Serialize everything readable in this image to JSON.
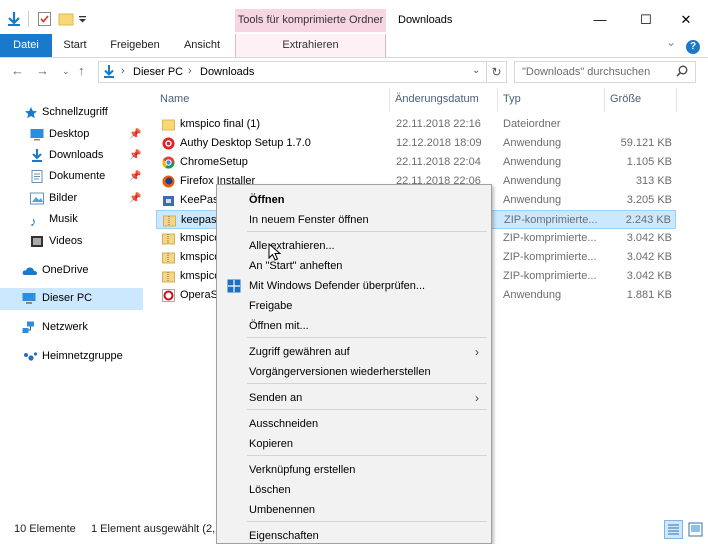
{
  "window": {
    "title": "Downloads",
    "context_tab": "Tools für komprimierte Ordner",
    "minimize_glyph": "—",
    "maximize_glyph": "☐",
    "close_glyph": "✕"
  },
  "ribbon": {
    "tabs": [
      "Datei",
      "Start",
      "Freigeben",
      "Ansicht",
      "Extrahieren"
    ],
    "expand_glyph": "⌄",
    "help_glyph": "?"
  },
  "address": {
    "breadcrumb": [
      "Dieser PC",
      "Downloads"
    ],
    "search_placeholder": "\"Downloads\" durchsuchen"
  },
  "navigation": {
    "items": [
      {
        "label": "Schnellzugriff",
        "icon": "star-icon",
        "pinned": false
      },
      {
        "label": "Desktop",
        "icon": "desktop-icon",
        "pinned": true
      },
      {
        "label": "Downloads",
        "icon": "download-arrow-icon",
        "pinned": true
      },
      {
        "label": "Dokumente",
        "icon": "document-icon",
        "pinned": true
      },
      {
        "label": "Bilder",
        "icon": "pictures-icon",
        "pinned": true
      },
      {
        "label": "Musik",
        "icon": "music-icon",
        "pinned": false
      },
      {
        "label": "Videos",
        "icon": "video-icon",
        "pinned": false
      },
      {
        "label": "OneDrive",
        "icon": "cloud-icon",
        "pinned": false
      },
      {
        "label": "Dieser PC",
        "icon": "computer-icon",
        "pinned": false
      },
      {
        "label": "Netzwerk",
        "icon": "network-icon",
        "pinned": false
      },
      {
        "label": "Heimnetzgruppe",
        "icon": "homegroup-icon",
        "pinned": false
      }
    ]
  },
  "filelist": {
    "columns": [
      "Name",
      "Änderungsdatum",
      "Typ",
      "Größe"
    ],
    "rows": [
      {
        "name": "kmspico final (1)",
        "date": "22.11.2018 22:16",
        "type": "Dateiordner",
        "size": "",
        "icon": "folder-icon"
      },
      {
        "name": "Authy Desktop Setup 1.7.0",
        "date": "12.12.2018 18:09",
        "type": "Anwendung",
        "size": "59.121 KB",
        "icon": "authy-icon"
      },
      {
        "name": "ChromeSetup",
        "date": "22.11.2018 22:04",
        "type": "Anwendung",
        "size": "1.105 KB",
        "icon": "chrome-icon"
      },
      {
        "name": "Firefox Installer",
        "date": "22.11.2018 22:06",
        "type": "Anwendung",
        "size": "313 KB",
        "icon": "firefox-icon"
      },
      {
        "name": "KeePass",
        "date": "",
        "type": "Anwendung",
        "size": "3.205 KB",
        "icon": "keepass-icon"
      },
      {
        "name": "keepass",
        "date": "",
        "type": "ZIP-komprimierte...",
        "size": "2.243 KB",
        "icon": "zip-folder-icon"
      },
      {
        "name": "kmspico",
        "date": "",
        "type": "ZIP-komprimierte...",
        "size": "3.042 KB",
        "icon": "zip-folder-icon"
      },
      {
        "name": "kmspico",
        "date": "",
        "type": "ZIP-komprimierte...",
        "size": "3.042 KB",
        "icon": "zip-folder-icon"
      },
      {
        "name": "kmspico",
        "date": "",
        "type": "ZIP-komprimierte...",
        "size": "3.042 KB",
        "icon": "zip-folder-icon"
      },
      {
        "name": "OperaSe",
        "date": "",
        "type": "Anwendung",
        "size": "1.881 KB",
        "icon": "opera-icon"
      }
    ],
    "selected_row": 5
  },
  "status": {
    "count": "10 Elemente",
    "selection": "1 Element ausgewählt (2,18"
  },
  "context_menu": {
    "items": [
      {
        "label": "Öffnen",
        "bold": true
      },
      {
        "label": "In neuem Fenster öffnen"
      },
      {
        "sep": true
      },
      {
        "label": "Alle extrahieren..."
      },
      {
        "label": "An \"Start\" anheften"
      },
      {
        "label": "Mit Windows Defender überprüfen...",
        "icon": "defender-icon"
      },
      {
        "label": "Freigabe"
      },
      {
        "label": "Öffnen mit..."
      },
      {
        "sep": true
      },
      {
        "label": "Zugriff gewähren auf",
        "submenu": true
      },
      {
        "label": "Vorgängerversionen wiederherstellen"
      },
      {
        "sep": true
      },
      {
        "label": "Senden an",
        "submenu": true
      },
      {
        "sep": true
      },
      {
        "label": "Ausschneiden"
      },
      {
        "label": "Kopieren"
      },
      {
        "sep": true
      },
      {
        "label": "Verknüpfung erstellen"
      },
      {
        "label": "Löschen"
      },
      {
        "label": "Umbenennen"
      },
      {
        "sep": true
      },
      {
        "label": "Eigenschaften"
      }
    ],
    "submenu_glyph": "›"
  },
  "colors": {
    "accent": "#1979ca",
    "context_tab": "#f8d5e2",
    "selection": "#cce8ff",
    "selection_border": "#99d1ff",
    "menu_bg": "#f2f2f2"
  }
}
